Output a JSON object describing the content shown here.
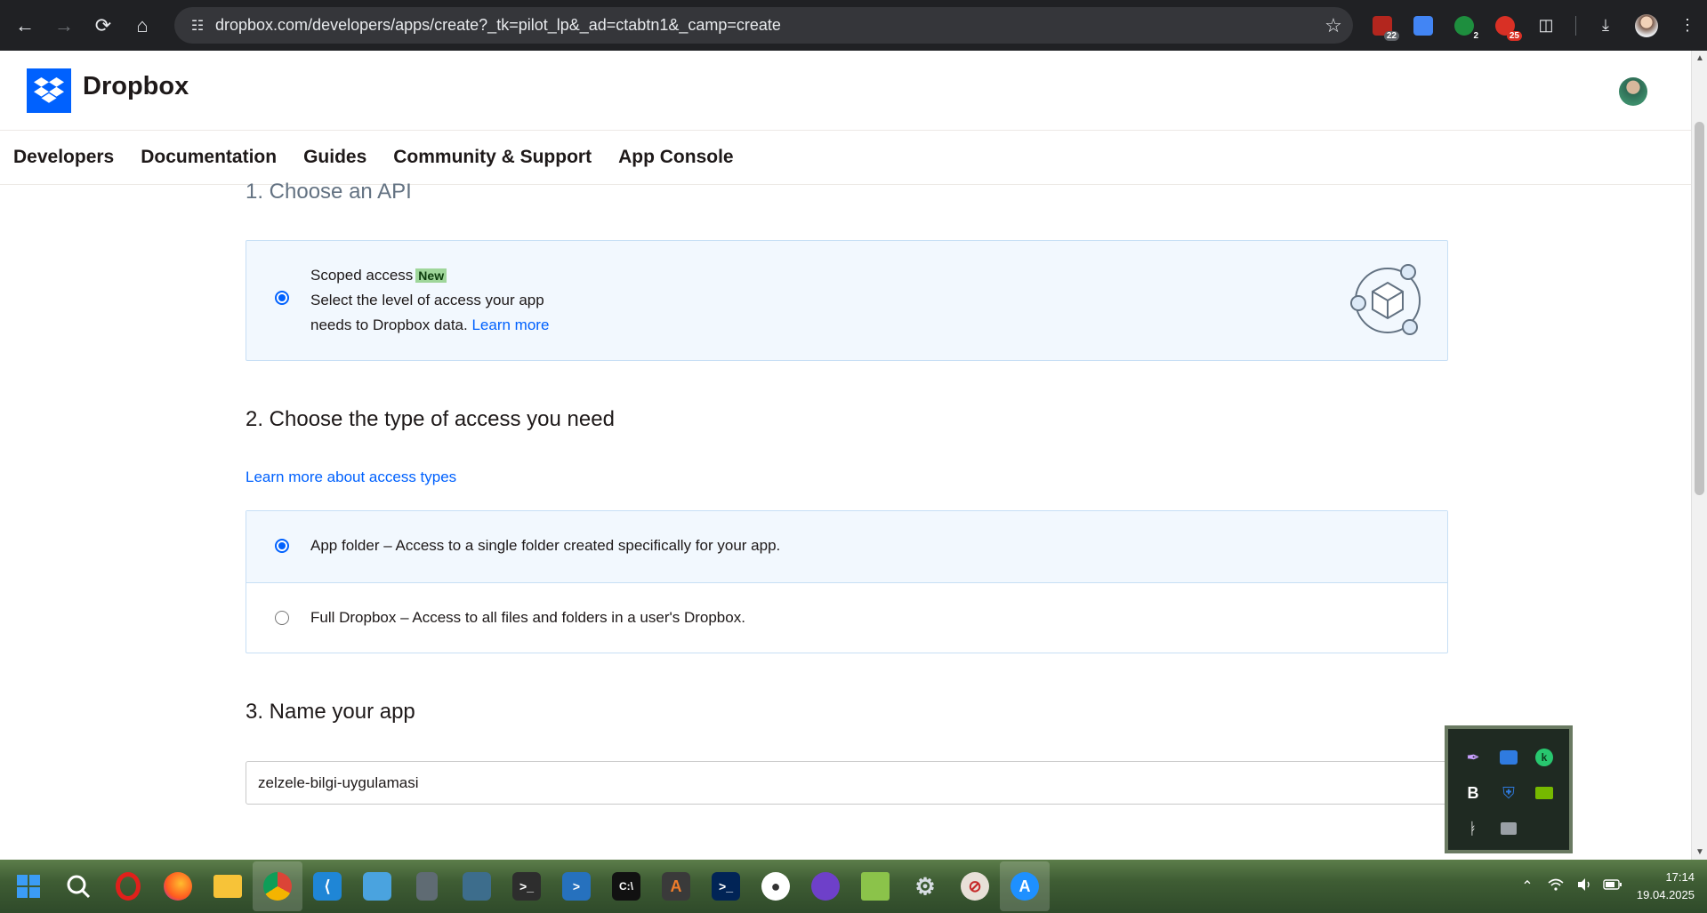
{
  "browser": {
    "url": "dropbox.com/developers/apps/create?_tk=pilot_lp&_ad=ctabtn1&_camp=create",
    "extensions": [
      {
        "name": "extension-1-icon",
        "badge": "22",
        "color": "#b3261e"
      },
      {
        "name": "google-translate-icon",
        "badge": "",
        "color": "#4285f4"
      },
      {
        "name": "extension-3-icon",
        "badge": "2",
        "color": "#1e8e3e"
      },
      {
        "name": "extension-4-icon",
        "badge": "25",
        "color": "#d93025"
      }
    ]
  },
  "header": {
    "brand": "Dropbox"
  },
  "nav": {
    "items": [
      "Developers",
      "Documentation",
      "Guides",
      "Community & Support",
      "App Console"
    ]
  },
  "step1": {
    "heading": "1. Choose an API",
    "option": {
      "title": "Scoped access",
      "badge": "New",
      "line1": "Select the level of access your app",
      "line2": "needs to Dropbox data.",
      "link": "Learn more"
    }
  },
  "step2": {
    "heading": "2. Choose the type of access you need",
    "link": "Learn more about access types",
    "options": [
      {
        "label": "App folder",
        "desc": "– Access to a single folder created specifically for your app."
      },
      {
        "label": "Full Dropbox",
        "desc": "– Access to all files and folders in a user's Dropbox."
      }
    ]
  },
  "step3": {
    "heading": "3. Name your app",
    "value": "zelzele-bilgi-uygulamasi"
  },
  "taskbar": {
    "time": "17:14",
    "date": "19.04.2025"
  },
  "colors": {
    "accent": "#0061fe",
    "selected_bg": "#f2f8fe",
    "new_badge": "#9fd69a"
  }
}
